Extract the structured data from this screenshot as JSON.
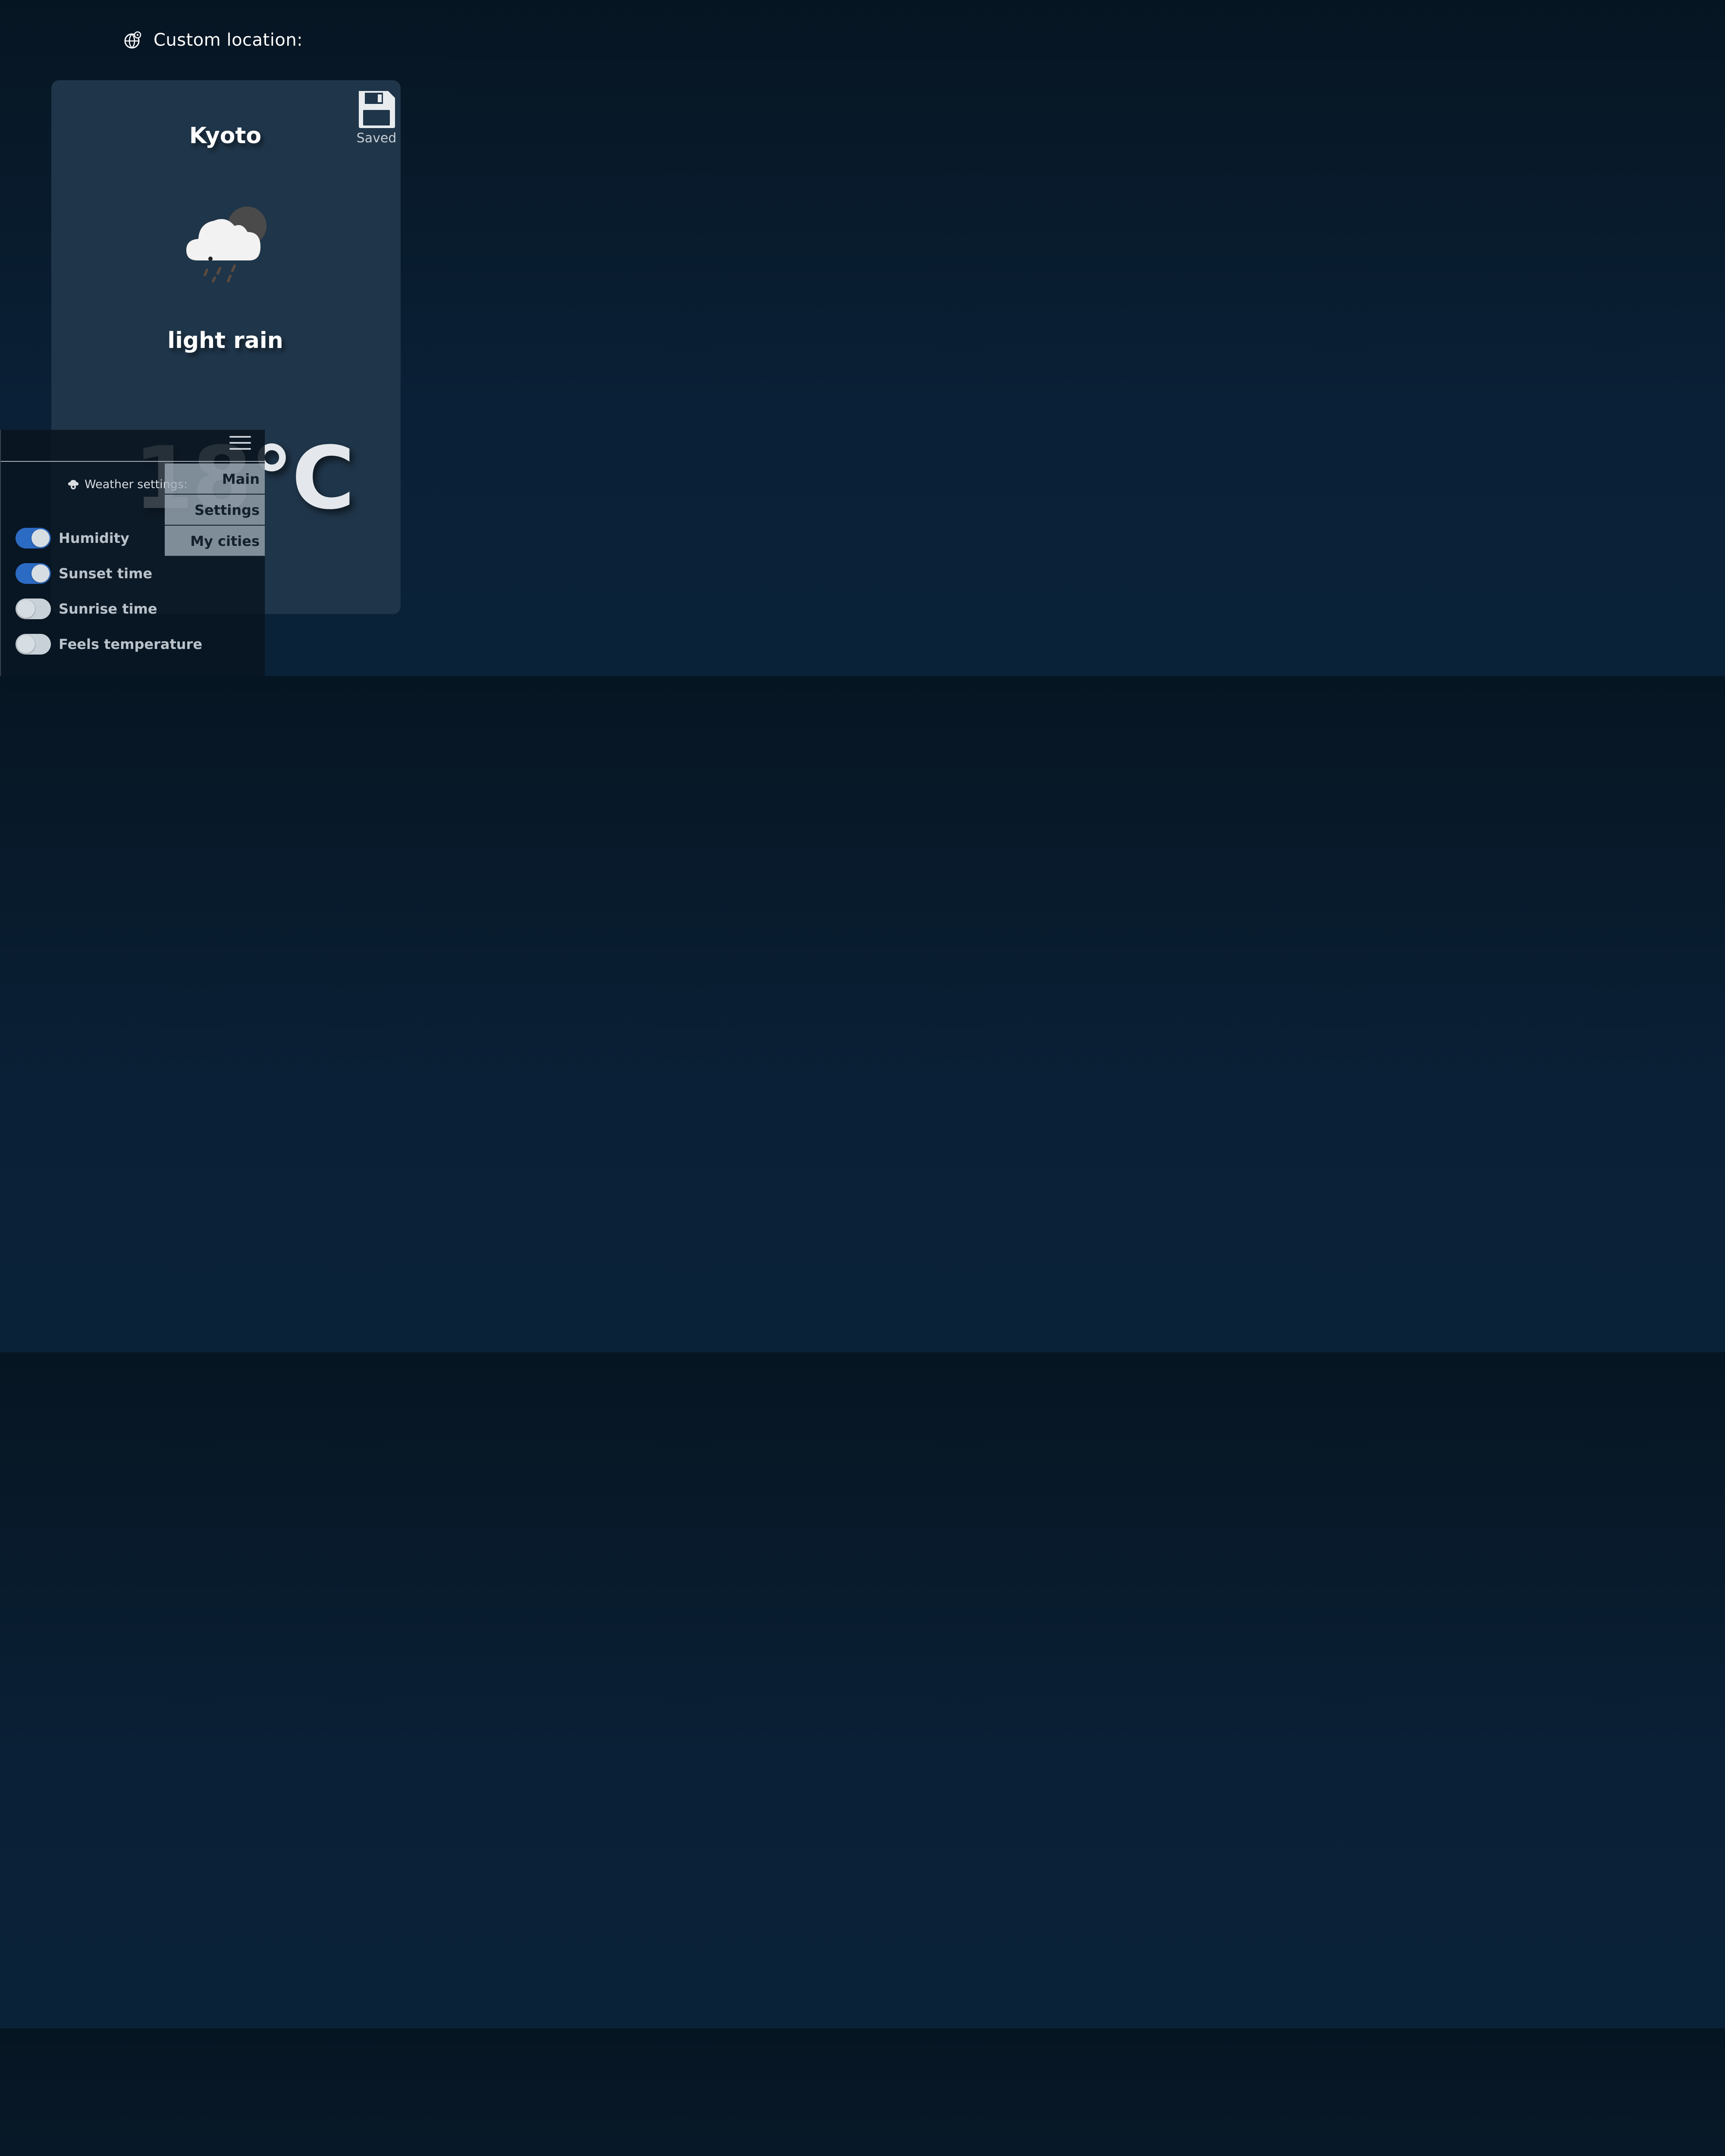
{
  "header": {
    "title": "Custom location:",
    "icon": "globe-pin-icon"
  },
  "card": {
    "city": "Kyoto",
    "description": "light rain",
    "temperature": "18°C",
    "weather_icon": "cloud-rain-night-icon",
    "save": {
      "label": "Saved",
      "icon": "floppy-disk-icon"
    }
  },
  "panel": {
    "menu_icon": "hamburger-icon",
    "menu": [
      {
        "label": "Main"
      },
      {
        "label": "Settings"
      },
      {
        "label": "My cities"
      }
    ],
    "settings_title": "Weather settings:",
    "settings_icon": "cloud-gear-icon",
    "toggles": [
      {
        "label": "Humidity",
        "on": true
      },
      {
        "label": "Sunset time",
        "on": true
      },
      {
        "label": "Sunrise time",
        "on": false
      },
      {
        "label": "Feels temperature",
        "on": false
      }
    ]
  },
  "colors": {
    "background": "#0a2036",
    "card": "#1f3549",
    "toggle_on": "#2c6bc4",
    "toggle_off": "#c9d1d8"
  }
}
